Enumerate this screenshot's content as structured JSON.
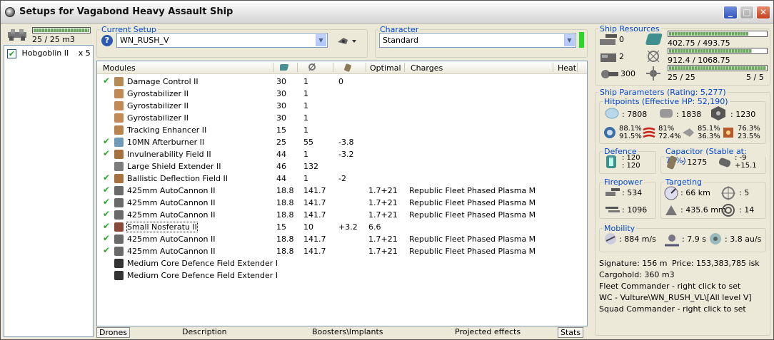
{
  "window": {
    "title": "Setups for Vagabond Heavy Assault Ship"
  },
  "drones": {
    "bay_text": "25 / 25 m3",
    "bay_fill": 1.0,
    "items": [
      {
        "name": "Hobgoblin II",
        "qty": "x 5",
        "checked": true
      }
    ]
  },
  "current_setup": {
    "legend": "Current Setup",
    "value": "WN_RUSH_V"
  },
  "character": {
    "legend": "Character",
    "value": "Standard"
  },
  "table": {
    "headers": {
      "modules": "Modules",
      "optimal": "Optimal",
      "charges": "Charges",
      "heat": "Heat"
    },
    "rows": [
      {
        "check": "✔",
        "name": "Damage Control II",
        "cpu": "30",
        "pg": "1",
        "cap": "0",
        "optimal": "",
        "charges": "",
        "icon": "#b58a55"
      },
      {
        "check": "",
        "name": "Gyrostabilizer II",
        "cpu": "30",
        "pg": "1",
        "cap": "",
        "optimal": "",
        "charges": "",
        "icon": "#c28a56"
      },
      {
        "check": "",
        "name": "Gyrostabilizer II",
        "cpu": "30",
        "pg": "1",
        "cap": "",
        "optimal": "",
        "charges": "",
        "icon": "#c28a56"
      },
      {
        "check": "",
        "name": "Gyrostabilizer II",
        "cpu": "30",
        "pg": "1",
        "cap": "",
        "optimal": "",
        "charges": "",
        "icon": "#c28a56"
      },
      {
        "check": "",
        "name": "Tracking Enhancer II",
        "cpu": "15",
        "pg": "1",
        "cap": "",
        "optimal": "",
        "charges": "",
        "icon": "#b98350"
      },
      {
        "check": "✔",
        "name": "10MN Afterburner II",
        "cpu": "25",
        "pg": "55",
        "cap": "-3.8",
        "optimal": "",
        "charges": "",
        "icon": "#6f9bb8"
      },
      {
        "check": "✔",
        "name": "Invulnerability Field II",
        "cpu": "44",
        "pg": "1",
        "cap": "-3.2",
        "optimal": "",
        "charges": "",
        "icon": "#a5713c"
      },
      {
        "check": "",
        "name": "Large Shield Extender II",
        "cpu": "46",
        "pg": "132",
        "cap": "",
        "optimal": "",
        "charges": "",
        "icon": "#7d7d7d"
      },
      {
        "check": "✔",
        "name": "Ballistic Deflection Field II",
        "cpu": "44",
        "pg": "1",
        "cap": "-2",
        "optimal": "",
        "charges": "",
        "icon": "#a5713c"
      },
      {
        "check": "✔",
        "name": "425mm AutoCannon II",
        "cpu": "18.8",
        "pg": "141.7",
        "cap": "",
        "optimal": "1.7+21",
        "charges": "Republic Fleet Phased Plasma M",
        "icon": "#6a6a6a"
      },
      {
        "check": "✔",
        "name": "425mm AutoCannon II",
        "cpu": "18.8",
        "pg": "141.7",
        "cap": "",
        "optimal": "1.7+21",
        "charges": "Republic Fleet Phased Plasma M",
        "icon": "#6a6a6a"
      },
      {
        "check": "✔",
        "name": "425mm AutoCannon II",
        "cpu": "18.8",
        "pg": "141.7",
        "cap": "",
        "optimal": "1.7+21",
        "charges": "Republic Fleet Phased Plasma M",
        "icon": "#6a6a6a"
      },
      {
        "check": "✔",
        "name": "Small Nosferatu II",
        "cpu": "15",
        "pg": "10",
        "cap": "+3.2",
        "optimal": "6.6",
        "charges": "",
        "icon": "#8a4a3a"
      },
      {
        "check": "✔",
        "name": "425mm AutoCannon II",
        "cpu": "18.8",
        "pg": "141.7",
        "cap": "",
        "optimal": "1.7+21",
        "charges": "Republic Fleet Phased Plasma M",
        "icon": "#6a6a6a"
      },
      {
        "check": "✔",
        "name": "425mm AutoCannon II",
        "cpu": "18.8",
        "pg": "141.7",
        "cap": "",
        "optimal": "1.7+21",
        "charges": "Republic Fleet Phased Plasma M",
        "icon": "#6a6a6a"
      },
      {
        "check": "",
        "name": "Medium Core Defence Field Extender I",
        "cpu": "",
        "pg": "",
        "cap": "",
        "optimal": "",
        "charges": "",
        "icon": "#333333"
      },
      {
        "check": "",
        "name": "Medium Core Defence Field Extender I",
        "cpu": "",
        "pg": "",
        "cap": "",
        "optimal": "",
        "charges": "",
        "icon": "#333333"
      }
    ]
  },
  "bottom_tabs": {
    "drones": "Drones",
    "description": "Description",
    "boosters": "Boosters\\Implants",
    "projected": "Projected effects",
    "stats": "Stats"
  },
  "resources": {
    "legend": "Ship Resources",
    "turret": "0",
    "launcher": "2",
    "calibration": "300",
    "cpu": "402.75 / 493.75",
    "cpu_fill": 0.8157,
    "pg": "912.4 / 1068.75",
    "pg_fill": 0.8537,
    "drone_bw": "25 / 25",
    "drone_bw_fill": 1.0,
    "drones_active": "5 / 5"
  },
  "params": {
    "legend": "Ship Parameters (Rating: 5,277)",
    "hitpoints": {
      "legend": "Hitpoints (Effective HP: 52,190)",
      "shield": ": 7808",
      "armor": ": 1838",
      "structure": ": 1230",
      "em": [
        "88.1%",
        "91.5%"
      ],
      "thermal": [
        "81%",
        "72.4%"
      ],
      "kinetic": [
        "85.1%",
        "36.3%"
      ],
      "explosive": [
        "76.3%",
        "23.5%"
      ]
    },
    "defence": {
      "legend": "Defence",
      "a": ": 120",
      "b": ": 120"
    },
    "capacitor": {
      "legend": "Capacitor (Stable at: 75%)",
      "cap": ": 1275",
      "a": ": -9",
      "b": "+15.1"
    },
    "firepower": {
      "legend": "Firepower",
      "a": ": 534",
      "b": ": 1096"
    },
    "targeting": {
      "legend": "Targeting",
      "range": ": 66 km",
      "targets": ": 5",
      "res": ": 435.6 mm",
      "sensor": ": 14"
    },
    "mobility": {
      "legend": "Mobility",
      "speed": ": 884 m/s",
      "align": ": 7.9 s",
      "warp": ": 3.8 au/s"
    }
  },
  "info": {
    "signature": "Signature: 156 m",
    "price": "Price: 153,383,785 isk",
    "cargohold": "Cargohold: 360 m3",
    "fleet": "Fleet Commander - right click to set",
    "wing": "WC - Vulture\\WN_RUSH_VL\\[All level V]",
    "squad": "Squad Commander - right click to set"
  },
  "colors": {
    "legend_blue": "#0046d5",
    "check_green": "#2fa52f",
    "bar_green": "#6da663"
  }
}
